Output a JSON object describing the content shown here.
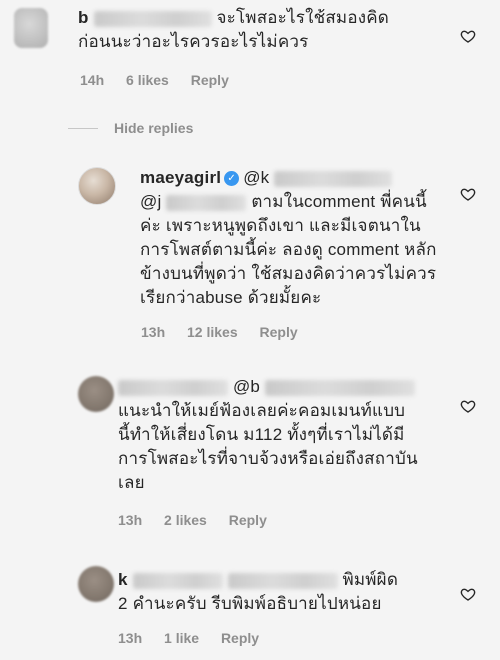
{
  "comments": [
    {
      "username": "b",
      "text_lines": [
        "จะโพสอะไรใช้สมองคิด",
        "ก่อนนะว่าอะไรควรอะไรไม่ควร"
      ],
      "time": "14h",
      "likes": "6 likes",
      "reply": "Reply"
    },
    {
      "username": "maeyagirl",
      "mention_top": "@k",
      "mention_second": "@j",
      "text_lines": [
        "ตามในcomment พี่คนนี้",
        "ค่ะ เพราะหนูพูดถึงเขา  และมีเจตนาใน",
        "การโพสต์ตามนี้ค่ะ ลองดู comment หลัก",
        "ข้างบนที่พูดว่า  ใช้สมองคิดว่าควรไม่ควร",
        "เรียกว่าabuse ด้วยมั้ยคะ"
      ],
      "time": "13h",
      "likes": "12 likes",
      "reply": "Reply"
    },
    {
      "mention": "@b",
      "text_lines": [
        "แนะนำให้เมย์ฟ้องเลยค่ะคอมเมนท์แบบ",
        "นี้ทำให้เสี่ยงโดน ม112 ทั้งๆที่เราไม่ได้มี",
        "การโพสอะไรที่จาบจ้วงหรือเอ่ยถึงสถาบัน",
        "เลย"
      ],
      "time": "13h",
      "likes": "2 likes",
      "reply": "Reply"
    },
    {
      "username": "k",
      "text_lines": [
        "พิมพ์ผิด",
        "2 คำนะครับ รีบพิมพ์อธิบายไปหน่อย"
      ],
      "time": "13h",
      "likes": "1 like",
      "reply": "Reply"
    }
  ],
  "hide_replies": "Hide replies"
}
